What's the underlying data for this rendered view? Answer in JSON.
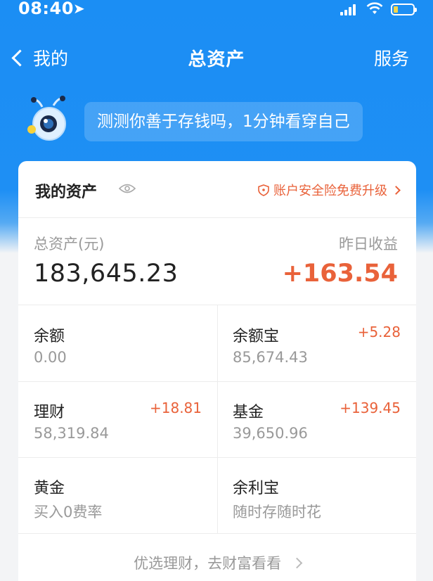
{
  "status_bar": {
    "time": "08:40"
  },
  "nav": {
    "back_label": "我的",
    "title": "总资产",
    "action_label": "服务"
  },
  "promo": {
    "text": "测测你善于存钱吗，1分钟看穿自己"
  },
  "assets_card": {
    "title": "我的资产",
    "security_link": "账户安全险免费升级",
    "total_label": "总资产(元)",
    "total_value": "183,645.23",
    "yesterday_label": "昨日收益",
    "yesterday_value": "+163.54",
    "items": [
      {
        "name": "余额",
        "change": "",
        "value": "0.00"
      },
      {
        "name": "余额宝",
        "change": "+5.28",
        "value": "85,674.43"
      },
      {
        "name": "理财",
        "change": "+18.81",
        "value": "58,319.84"
      },
      {
        "name": "基金",
        "change": "+139.45",
        "value": "39,650.96"
      },
      {
        "name": "黄金",
        "change": "",
        "value": "买入0费率"
      },
      {
        "name": "余利宝",
        "change": "",
        "value": "随时存随时花"
      }
    ],
    "footer_link": "优选理财，去财富看看"
  },
  "colors": {
    "brand_blue": "#1b8ef4",
    "accent_orange": "#e9623a"
  }
}
